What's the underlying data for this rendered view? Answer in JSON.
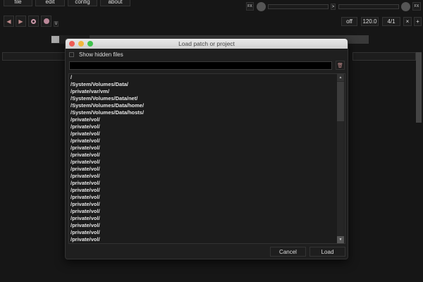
{
  "menu": [
    "file",
    "edit",
    "config",
    "about"
  ],
  "transport": {
    "toggle_label": "\\/"
  },
  "mixer": {
    "fx_left": "FX",
    "fx_right": "FX",
    "arrow": ">"
  },
  "status": {
    "sync": "off",
    "tempo": "120.0",
    "signature": "4/1",
    "close": "×",
    "add": "+"
  },
  "dialog": {
    "title": "Load patch or project",
    "show_hidden_label": "Show hidden files",
    "path_value": "",
    "items": [
      "/",
      "/System/Volumes/Data/",
      "/private/var/vm/",
      "/System/Volumes/Data/net/",
      "/System/Volumes/Data/home/",
      "/System/Volumes/Data/hosts/",
      "/private/vol/",
      "/private/vol/",
      "/private/vol/",
      "/private/vol/",
      "/private/vol/",
      "/private/vol/",
      "/private/vol/",
      "/private/vol/",
      "/private/vol/",
      "/private/vol/",
      "/private/vol/",
      "/private/vol/",
      "/private/vol/",
      "/private/vol/",
      "/private/vol/",
      "/private/vol/",
      "/private/vol/",
      "/private/vol/"
    ],
    "cancel": "Cancel",
    "load": "Load"
  }
}
